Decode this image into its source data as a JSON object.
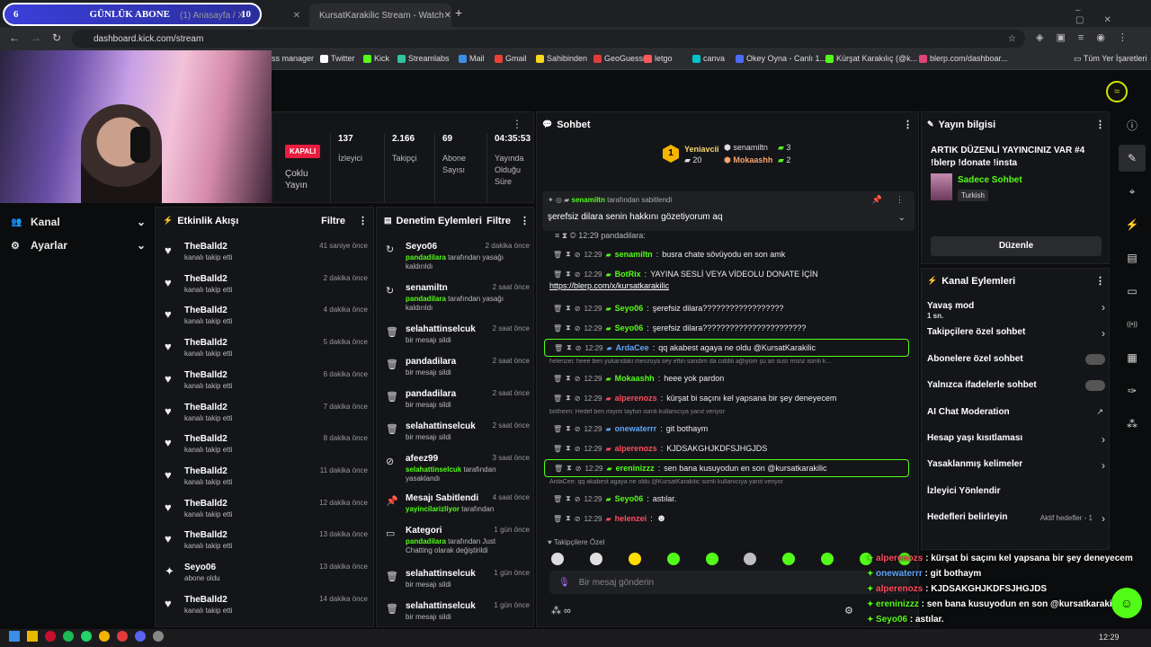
{
  "browser": {
    "tabs": [
      {
        "label": "(1) Anasayfa / X"
      },
      {
        "label": "KursatKarakilic Stream - Watch"
      }
    ],
    "overlay": {
      "left": "6",
      "title": "GÜNLÜK ABONE",
      "right": "10"
    },
    "new_tab": "+",
    "url": "dashboard.kick.com/stream",
    "bookmarks": [
      "ss manager",
      "Twitter",
      "Kick",
      "Streamlabs",
      "Mail",
      "Gmail",
      "Sahibinden",
      "GeoGuessr",
      "letgo",
      "canva",
      "Okey Oyna - Canlı 1...",
      "Kürşat Karakılıç (@k...",
      "blerp.com/dashboar..."
    ],
    "bookmarks_folder": "Tüm Yer İşaretleri"
  },
  "sidebar": {
    "items": [
      {
        "label": "Kanal"
      },
      {
        "label": "Ayarlar"
      }
    ]
  },
  "stats": {
    "status": "KAPALI",
    "status_sub": "Çoklu Yayın",
    "items": [
      {
        "value": "137",
        "label": "İzleyici"
      },
      {
        "value": "2.166",
        "label": "Takipçi"
      },
      {
        "value": "69",
        "label": "Abone Sayısı"
      },
      {
        "value": "04:35:53",
        "label": "Yayında Olduğu Süre"
      }
    ]
  },
  "activity": {
    "title": "Etkinlik Akışı",
    "filter": "Filtre",
    "items": [
      {
        "user": "TheBalld2",
        "action": "kanalı takip etti",
        "time": "41 saniye önce"
      },
      {
        "user": "TheBalld2",
        "action": "kanalı takip etti",
        "time": "2 dakika önce"
      },
      {
        "user": "TheBalld2",
        "action": "kanalı takip etti",
        "time": "4 dakika önce"
      },
      {
        "user": "TheBalld2",
        "action": "kanalı takip etti",
        "time": "5 dakika önce"
      },
      {
        "user": "TheBalld2",
        "action": "kanalı takip etti",
        "time": "6 dakika önce"
      },
      {
        "user": "TheBalld2",
        "action": "kanalı takip etti",
        "time": "7 dakika önce"
      },
      {
        "user": "TheBalld2",
        "action": "kanalı takip etti",
        "time": "8 dakika önce"
      },
      {
        "user": "TheBalld2",
        "action": "kanalı takip etti",
        "time": "11 dakika önce"
      },
      {
        "user": "TheBalld2",
        "action": "kanalı takip etti",
        "time": "12 dakika önce"
      },
      {
        "user": "TheBalld2",
        "action": "kanalı takip etti",
        "time": "13 dakika önce"
      },
      {
        "user": "Seyo06",
        "action": "abone oldu",
        "time": "13 dakika önce"
      },
      {
        "user": "TheBalld2",
        "action": "kanalı takip etti",
        "time": "14 dakika önce"
      }
    ]
  },
  "mod_actions": {
    "title": "Denetim Eylemleri",
    "filter": "Filtre",
    "items": [
      {
        "user": "Seyo06",
        "time": "2 dakika önce",
        "by": "pandadilara",
        "rest": "tarafından yasağı kaldırıldı"
      },
      {
        "user": "senamiltn",
        "time": "2 saat önce",
        "by": "pandadilara",
        "rest": "tarafından yasağı kaldırıldı"
      },
      {
        "user": "selahattinselcuk",
        "time": "2 saat önce",
        "by": "",
        "rest": "bir mesajı sildi"
      },
      {
        "user": "pandadilara",
        "time": "2 saat önce",
        "by": "",
        "rest": "bir mesajı sildi"
      },
      {
        "user": "pandadilara",
        "time": "2 saat önce",
        "by": "",
        "rest": "bir mesajı sildi"
      },
      {
        "user": "selahattinselcuk",
        "time": "2 saat önce",
        "by": "",
        "rest": "bir mesajı sildi"
      },
      {
        "user": "afeez99",
        "time": "3 saat önce",
        "by": "selahattinselcuk",
        "rest": "tarafından yasaklandı"
      },
      {
        "user": "Mesajı Sabitlendi",
        "time": "4 saat önce",
        "by": "yayincilarizliyor",
        "rest": "tarafından"
      },
      {
        "user": "Kategori",
        "time": "1 gün önce",
        "by": "pandadilara",
        "rest": "tarafından Just Chatting olarak değiştirildi"
      },
      {
        "user": "selahattinselcuk",
        "time": "1 gün önce",
        "by": "",
        "rest": "bir mesajı sildi"
      },
      {
        "user": "selahattinselcuk",
        "time": "1 gün önce",
        "by": "",
        "rest": "bir mesajı sildi"
      }
    ]
  },
  "chat": {
    "title": "Sohbet",
    "leaders": [
      {
        "rank": "1",
        "name": "Yeniavcii",
        "count": "20"
      },
      {
        "name": "senamiltn",
        "count": "3"
      },
      {
        "name": "Mokaashh",
        "count": "2"
      }
    ],
    "pinned": {
      "by": "senamiltn",
      "by_suffix": "tarafından sabitlendi",
      "text": "şerefsiz dilara senin hakkını gözetiyorum aq"
    },
    "messages": [
      {
        "t": "12:29",
        "user": "senamiltn",
        "color": "#53fc18",
        "text": "busra chate sövüyodu en son amk",
        "hl": false,
        "reply": ""
      },
      {
        "t": "12:29",
        "user": "BotRix",
        "color": "#53fc18",
        "text": "YAYINA SESLİ VEYA VİDEOLU DONATE İÇİN",
        "hl": false,
        "reply": ""
      },
      {
        "t": "12:29",
        "user": "Seyo06",
        "color": "#53fc18",
        "text": "şerefsiz dilara??????????????????",
        "hl": false,
        "reply": ""
      },
      {
        "t": "12:29",
        "user": "Seyo06",
        "color": "#53fc18",
        "text": "şerefsiz dilara???????????????????????",
        "hl": false,
        "reply": ""
      },
      {
        "t": "12:29",
        "user": "ArdaCee",
        "color": "#60a5fa",
        "text": "qq akabest agaya ne oldu @KursatKarakilic",
        "hl": true,
        "reply": ""
      },
      {
        "t": "12:29",
        "user": "Mokaashh",
        "color": "#53fc18",
        "text": "heee yok pardon",
        "hl": false,
        "reply": "helenzei: heee ben yukarıdaki mevzuya sey ettin sandım da ciddili ağlıyom şu an susr msnz isimli k..."
      },
      {
        "t": "12:29",
        "user": "alperenozs",
        "color": "#ff4d5e",
        "text": "kürşat bi saçını kel yapsana bir şey deneyecem",
        "hl": false,
        "reply": ""
      },
      {
        "t": "12:29",
        "user": "onewaterrr",
        "color": "#60a5fa",
        "text": "git bothaym",
        "hl": false,
        "reply": "botheim: Hedef ben miyim tayfun isimli kullanıcıya yanıt veriyor"
      },
      {
        "t": "12:29",
        "user": "alperenozs",
        "color": "#ff4d5e",
        "text": "KJDSAKGHJKDFSJHGJDS",
        "hl": false,
        "reply": ""
      },
      {
        "t": "12:29",
        "user": "ereninizzz",
        "color": "#53fc18",
        "text": "sen bana kusuyodun en son @kursatkarakilic",
        "hl": true,
        "reply": ""
      },
      {
        "t": "12:29",
        "user": "Seyo06",
        "color": "#53fc18",
        "text": "astılar.",
        "hl": false,
        "reply": "ArdaCee: qq akabest agaya ne oldu @KursatKarakilic isimli kullanıcıya yanıt veriyor"
      },
      {
        "t": "12:29",
        "user": "helenzei",
        "color": "#ff4d5e",
        "text": "",
        "hl": false,
        "reply": ""
      }
    ],
    "top_cut": "pandadilara:",
    "link": "https://blerp.com/x/kursatkarakilic",
    "followers_only": "Takipçilere Özel",
    "input_placeholder": "Bir mesaj gönderin"
  },
  "stream_info": {
    "title": "Yayın bilgisi",
    "stream_title": "ARTIK DÜZENLİ YAYINCINIZ VAR #4 !blerp !donate !insta",
    "category": "Sadece Sohbet",
    "language": "Turkish",
    "edit": "Düzenle"
  },
  "channel_actions": {
    "title": "Kanal Eylemleri",
    "items": [
      {
        "label": "Yavaş mod",
        "sub": "1 sn.",
        "ctrl": "chevron"
      },
      {
        "label": "Takipçilere özel sohbet",
        "sub": "",
        "ctrl": "chevron"
      },
      {
        "label": "Abonelere özel sohbet",
        "sub": "",
        "ctrl": "toggle"
      },
      {
        "label": "Yalnızca ifadelerle sohbet",
        "sub": "",
        "ctrl": "toggle"
      },
      {
        "label": "AI Chat Moderation",
        "sub": "",
        "ctrl": "external"
      },
      {
        "label": "Hesap yaşı kısıtlaması",
        "sub": "",
        "ctrl": "chevron"
      },
      {
        "label": "Yasaklanmış kelimeler",
        "sub": "",
        "ctrl": "chevron"
      },
      {
        "label": "İzleyici Yönlendir",
        "sub": "",
        "ctrl": "none"
      },
      {
        "label": "Hedefleri belirleyin",
        "sub": "Aktif hedefler - 1",
        "ctrl": "chevron"
      }
    ]
  },
  "overlay_chat": [
    {
      "user": "alperenozs",
      "color": "#ff4d5e",
      "text": "kürşat bi saçını kel yapsana bir şey deneyecem"
    },
    {
      "user": "onewaterrr",
      "color": "#60a5fa",
      "text": "git bothaym"
    },
    {
      "user": "alperenozs",
      "color": "#ff4d5e",
      "text": "KJDSAKGHJKDFSJHGJDS"
    },
    {
      "user": "ereninizzz",
      "color": "#53fc18",
      "text": "sen bana kusuyodun en son @kursatkarakilic"
    },
    {
      "user": "Seyo06",
      "color": "#53fc18",
      "text": "astılar."
    },
    {
      "user": "helenzei",
      "color": "#ff4d5e",
      "text": ""
    }
  ],
  "taskbar": {
    "time": "12:29"
  }
}
